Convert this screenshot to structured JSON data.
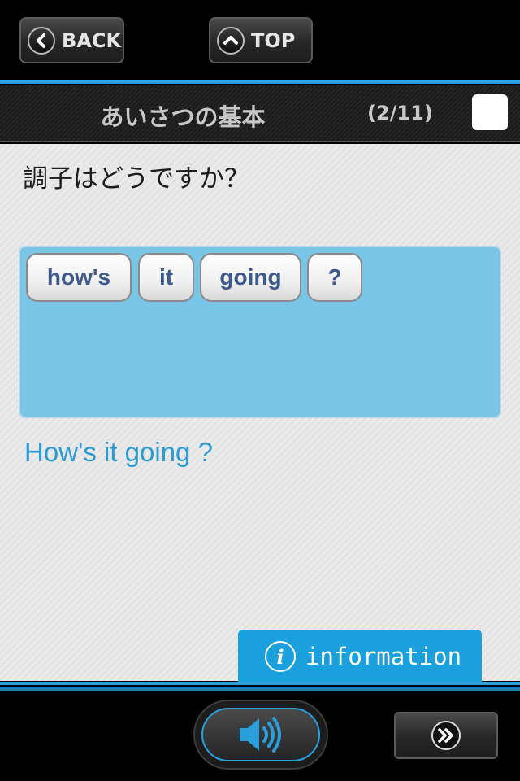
{
  "nav": {
    "back_label": "BACK",
    "top_label": "TOP",
    "back_icon": "chevron-left-icon",
    "top_icon": "chevron-up-icon"
  },
  "header": {
    "title": "あいさつの基本",
    "counter": "(2/11)",
    "checked": false
  },
  "question": "調子はどうですか？",
  "words": [
    "how's",
    "it",
    "going",
    "?"
  ],
  "translation": "How's it going ?",
  "info": {
    "label": "information",
    "icon": "info-icon"
  },
  "controls": {
    "audio_icon": "speaker-icon",
    "next_icon": "double-chevron-right-icon"
  },
  "colors": {
    "accent": "#2a9fdc",
    "answer_bg": "#79c5e7",
    "translation": "#2a9ad2"
  }
}
